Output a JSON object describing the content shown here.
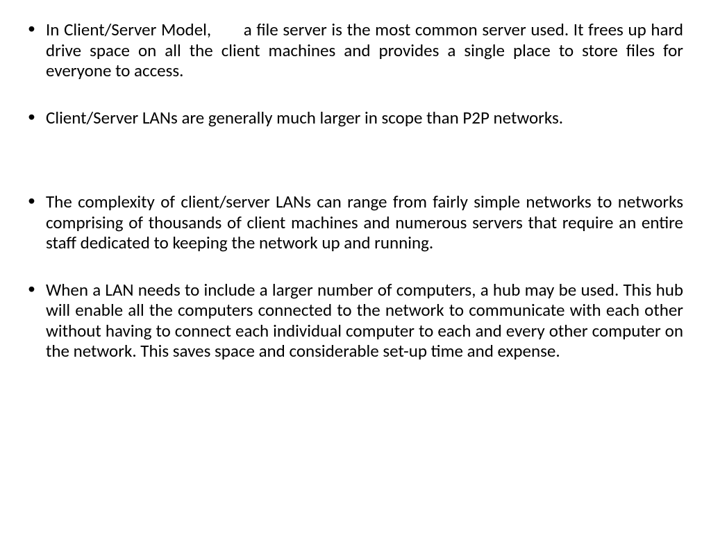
{
  "bullets": [
    {
      "lead": "In Client/Server Model,       ",
      "rest": "a file server is the most common server used. It frees up hard drive space on all the client machines and provides a single place to store files for everyone to access."
    },
    {
      "text": "Client/Server LANs are generally much larger in scope than P2P networks."
    },
    {
      "text": "The complexity of client/server LANs can range from fairly simple networks to networks comprising of thousands of client machines and numerous servers that require an entire staff dedicated to keeping the network up and running."
    },
    {
      "text": "When a LAN needs to include a larger number of computers, a hub may be used. This hub will enable all the computers connected to the network to communicate with each other without having to connect each individual computer to each and every other computer on the network. This saves space and considerable set-up time and expense."
    }
  ]
}
